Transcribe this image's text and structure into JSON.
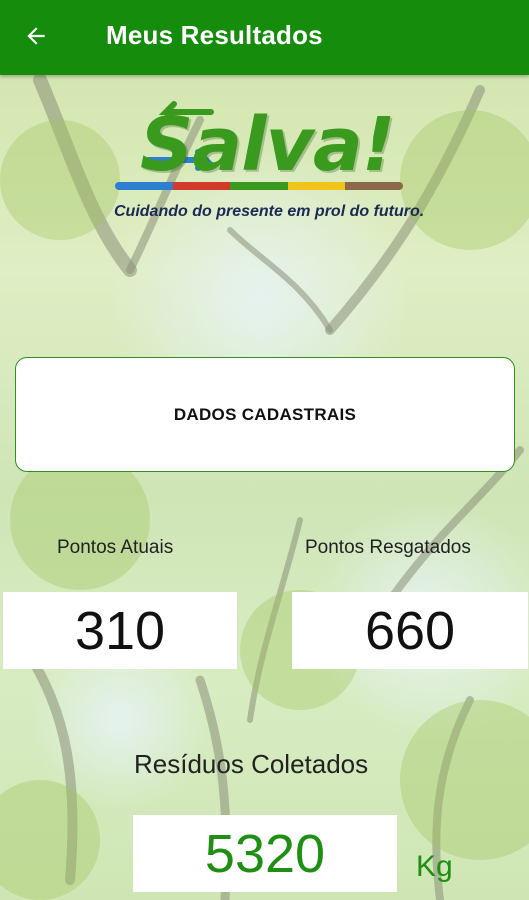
{
  "appbar": {
    "title": "Meus Resultados",
    "back_icon": "arrow-left-icon",
    "color": "#168c0d"
  },
  "logo": {
    "word": "Salva!",
    "slogan": "Cuidando do presente em prol do futuro.",
    "stripe_colors": [
      "#2f7fd0",
      "#d43a2a",
      "#3a9a1e",
      "#f0c419",
      "#8a6a4a"
    ]
  },
  "card": {
    "label": "DADOS CADASTRAIS"
  },
  "stats": {
    "pontos_atuais": {
      "label": "Pontos Atuais",
      "value": "310"
    },
    "pontos_resgatados": {
      "label": "Pontos Resgatados",
      "value": "660"
    }
  },
  "residuos": {
    "label": "Resíduos Coletados",
    "value": "5320",
    "unit": "Kg",
    "color": "#1f8f14"
  }
}
